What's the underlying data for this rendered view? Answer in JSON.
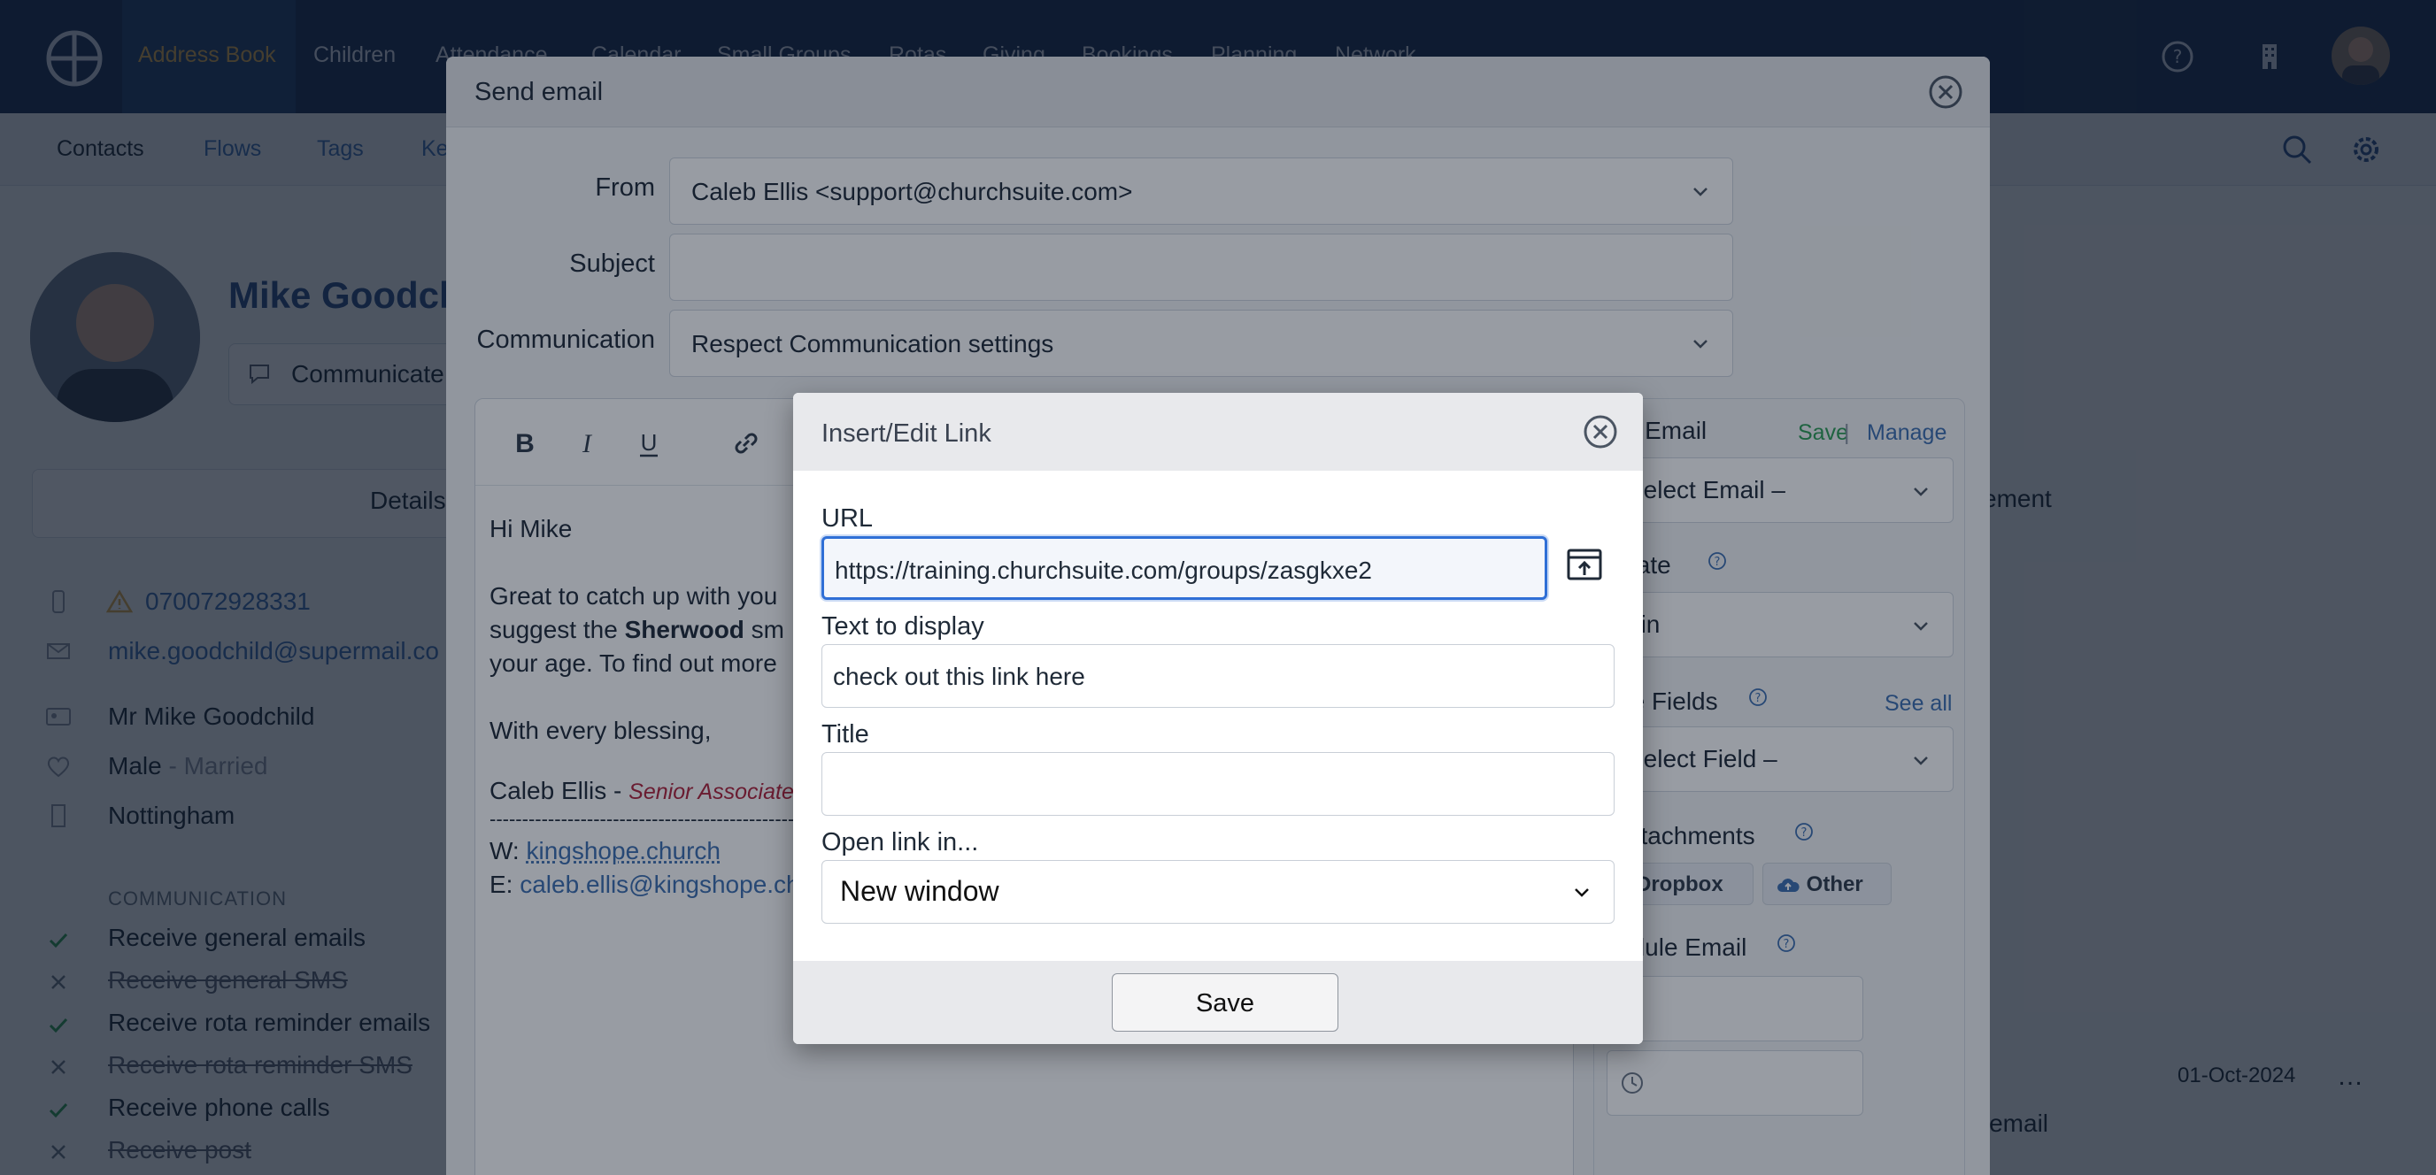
{
  "nav": {
    "items": [
      "Address Book",
      "Children",
      "Attendance",
      "Calendar",
      "Small Groups",
      "Rotas",
      "Giving",
      "Bookings",
      "Planning",
      "Network"
    ],
    "active": "Address Book",
    "icons": [
      "help-icon",
      "building-icon",
      "avatar"
    ]
  },
  "subnav": {
    "items": [
      "Contacts",
      "Flows",
      "Tags",
      "Ke"
    ],
    "active": "Contacts"
  },
  "profile": {
    "name": "Mike Goodch",
    "communicate_label": "Communicate",
    "tab_details": "Details",
    "tab_management": "ement",
    "phone": "070072928331",
    "email": "mike.goodchild@supermail.co",
    "full_name": "Mr Mike Goodchild",
    "gender": "Male",
    "marital": " - Married",
    "location": "Nottingham",
    "communication_heading": "COMMUNICATION",
    "communication": [
      {
        "label": "Receive general emails",
        "enabled": true
      },
      {
        "label": "Receive general SMS",
        "enabled": false
      },
      {
        "label": "Receive rota reminder emails",
        "enabled": true
      },
      {
        "label": "Receive rota reminder SMS",
        "enabled": false
      },
      {
        "label": "Receive phone calls",
        "enabled": true
      },
      {
        "label": "Receive post",
        "enabled": false
      }
    ],
    "timeline_date": "01-Oct-2024",
    "timeline_text": "r email"
  },
  "send_email": {
    "title": "Send email",
    "from_label": "From",
    "from_value": "Caleb Ellis <support@churchsuite.com>",
    "subject_label": "Subject",
    "subject_value": "",
    "communication_label": "Communication",
    "communication_value": "Respect Communication settings",
    "body": {
      "greeting": "Hi Mike",
      "line1": "Great to catch up with you",
      "line2_pre": "suggest the ",
      "line2_bold": "Sherwood",
      "line2_post": " sm",
      "line3": "your age. To find out more",
      "sign": "With every blessing,",
      "sig_name": "Caleb Ellis - ",
      "sig_role": "Senior Associate",
      "divider": "------------------------------------------------",
      "web_prefix": "W: ",
      "web_link": "kingshope.church",
      "email_prefix": "E: ",
      "email_link": "caleb.ellis@kingshope.ch"
    },
    "panel": {
      "preset_label": "et Email",
      "save": "Save",
      "sep": " | ",
      "manage": "Manage",
      "preset_select": "Select Email –",
      "template_label": "plate",
      "template_value": "ain",
      "merge_label": "ge Fields",
      "see_all": "See all",
      "merge_select": "Select Field –",
      "attachments_label": "Attachments",
      "dropbox": "Dropbox",
      "other": "Other",
      "schedule_label": "edule Email"
    }
  },
  "link_dialog": {
    "title": "Insert/Edit Link",
    "url_label": "URL",
    "url_value": "https://training.churchsuite.com/groups/zasgkxe2",
    "text_label": "Text to display",
    "text_value": "check out this link here",
    "title_label": "Title",
    "title_value": "",
    "target_label": "Open link in...",
    "target_value": "New window",
    "save_label": "Save"
  },
  "colors": {
    "nav_bg": "#1b3155",
    "accent": "#3d6fb0",
    "active_nav": "#d8a84a",
    "focus": "#2f6fd6",
    "enabled": "#2e9e55"
  }
}
